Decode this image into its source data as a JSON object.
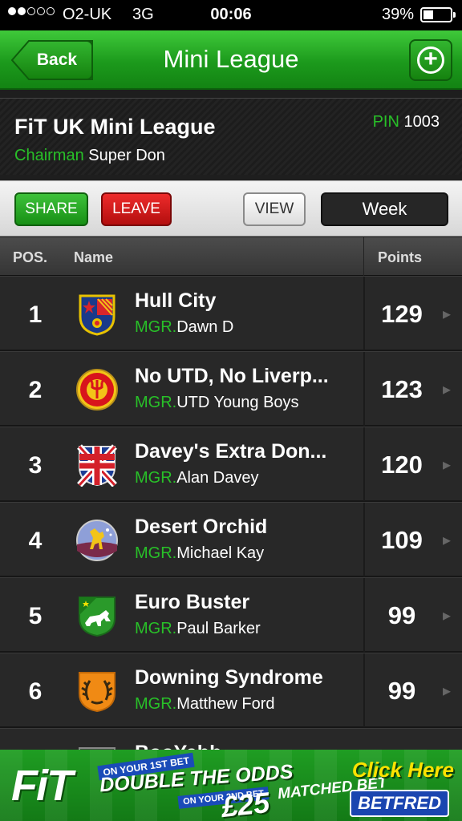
{
  "status_bar": {
    "carrier": "O2-UK",
    "network": "3G",
    "time": "00:06",
    "battery": "39%",
    "battery_level": 0.39,
    "signal_bars": 2
  },
  "nav": {
    "back_label": "Back",
    "title": "Mini League",
    "add_icon": "plus-circle-icon"
  },
  "league": {
    "name": "FiT UK Mini League",
    "pin_label": "PIN",
    "pin": "1003",
    "chairman_label": "Chairman",
    "chairman": "Super Don"
  },
  "actions": {
    "share": "SHARE",
    "leave": "LEAVE",
    "view": "VIEW",
    "period": "Week"
  },
  "table": {
    "headers": {
      "pos": "POS.",
      "name": "Name",
      "points": "Points"
    },
    "mgr_label": "MGR.",
    "rows": [
      {
        "pos": "1",
        "team": "Hull City",
        "manager": "Dawn D",
        "points": "129",
        "crest": "hull-crest-icon"
      },
      {
        "pos": "2",
        "team": "No UTD, No Liverp...",
        "manager": "UTD Young Boys",
        "points": "123",
        "crest": "utd-crest-icon"
      },
      {
        "pos": "3",
        "team": "Davey's Extra Don...",
        "manager": "Alan Davey",
        "points": "120",
        "crest": "uk-mini-league-crest-icon"
      },
      {
        "pos": "4",
        "team": "Desert Orchid",
        "manager": "Michael Kay",
        "points": "109",
        "crest": "horse-crest-icon"
      },
      {
        "pos": "5",
        "team": "Euro Buster",
        "manager": "Paul Barker",
        "points": "99",
        "crest": "wolf-crest-icon"
      },
      {
        "pos": "6",
        "team": "Downing Syndrome",
        "manager": "Matthew Ford",
        "points": "99",
        "crest": "laurel-crest-icon"
      },
      {
        "pos": "",
        "team": "BooYabb",
        "manager": "",
        "points": "",
        "crest": "partial-crest-icon"
      }
    ]
  },
  "ad": {
    "logo": "FiT",
    "tag1": "ON YOUR 1ST BET",
    "headline": "DOUBLE THE ODDS",
    "tag2": "ON YOUR 2ND BET",
    "amount": "£25",
    "matched": "MATCHED BET",
    "cta": "Click Here",
    "brand": "BETFRED"
  },
  "colors": {
    "accent_green": "#28c028",
    "nav_green": "#1c9a1c",
    "leave_red": "#d41a1a",
    "row_bg": "#282828"
  }
}
